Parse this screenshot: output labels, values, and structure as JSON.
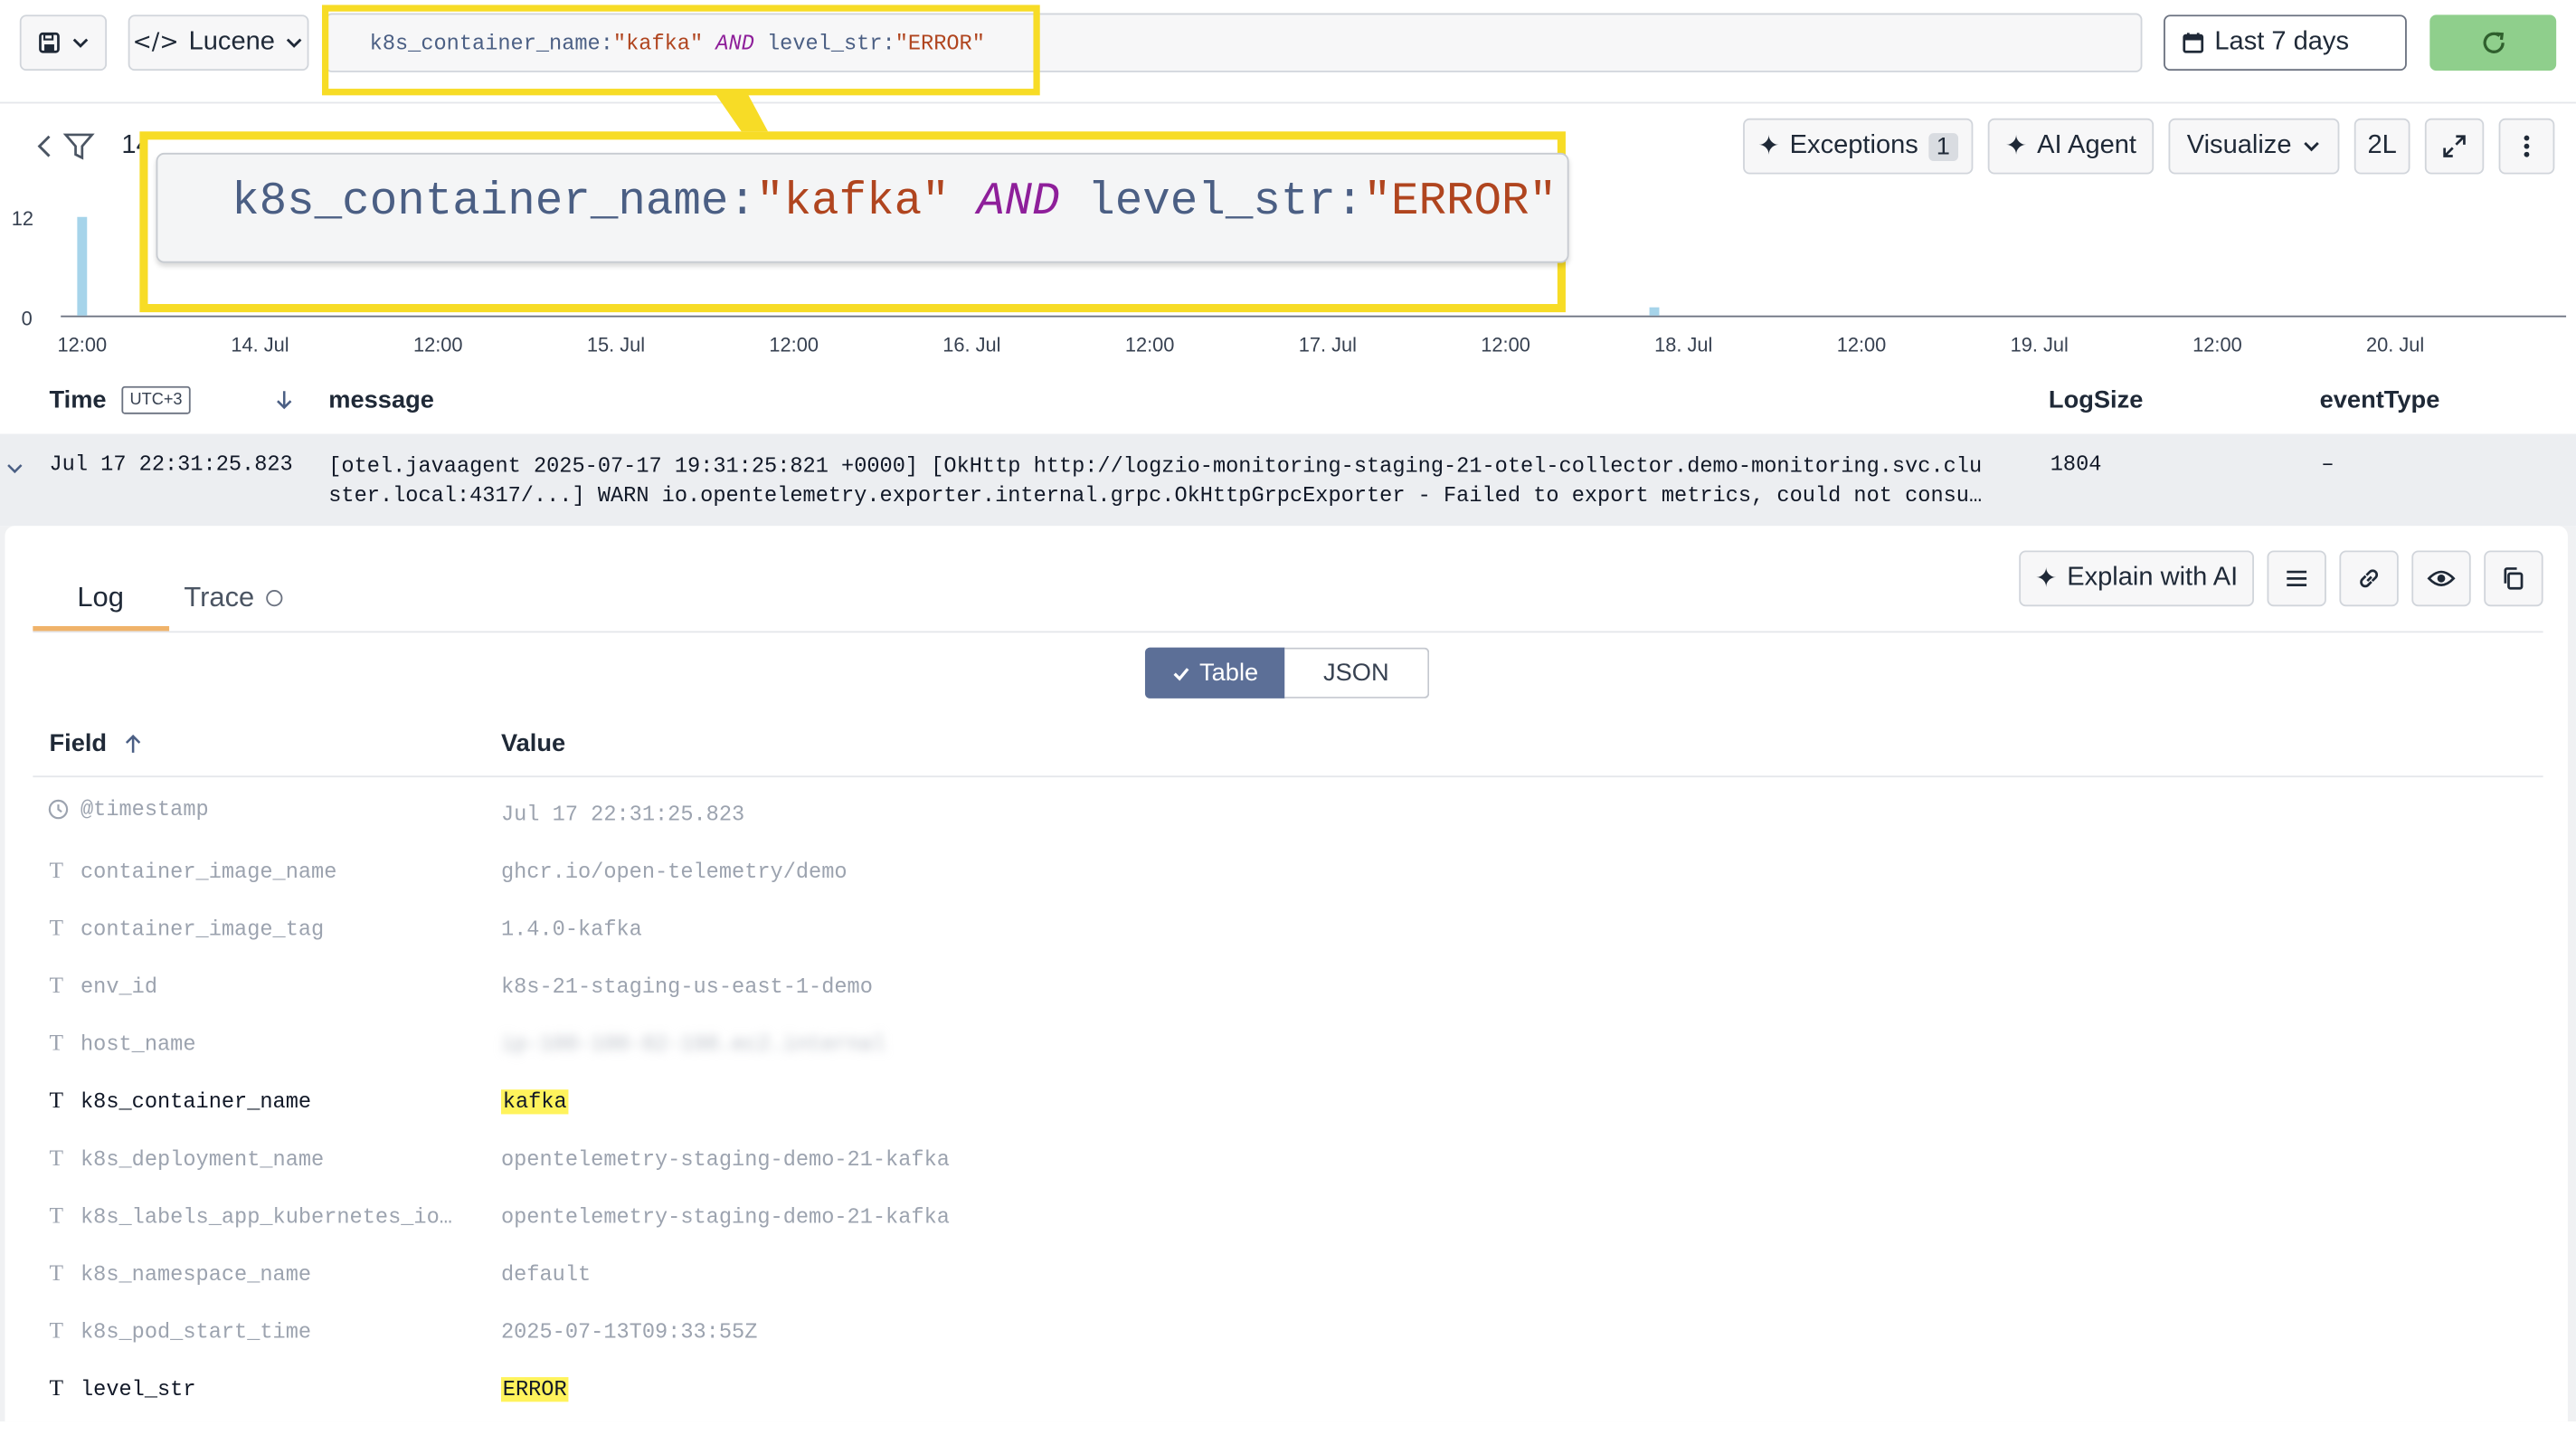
{
  "toolbar": {
    "query_language": "Lucene",
    "query_parts": [
      "k8s_container_name",
      ":",
      "\"kafka\"",
      " AND ",
      "level_str",
      ":",
      "\"ERROR\""
    ],
    "time_range": "Last 7 days"
  },
  "zoom_callout": {
    "parts": [
      "k8s_container_name",
      ":",
      "\"kafka\"",
      " AND ",
      "level_str",
      ":",
      "\"ERROR\""
    ]
  },
  "actions": {
    "exceptions_label": "Exceptions",
    "exceptions_count": "1",
    "ai_agent_label": "AI Agent",
    "visualize_label": "Visualize",
    "lines_label": "2L"
  },
  "hits_partial": "14",
  "chart_data": {
    "type": "bar",
    "y_ticks": [
      "12",
      "0"
    ],
    "x_ticks": [
      "12:00",
      "14. Jul",
      "12:00",
      "15. Jul",
      "12:00",
      "16. Jul",
      "12:00",
      "17. Jul",
      "12:00",
      "18. Jul",
      "12:00",
      "19. Jul",
      "12:00",
      "20. Jul"
    ],
    "ylim": [
      0,
      12
    ],
    "x_domain": [
      "2025-07-13T12:00",
      "2025-07-20T00:00"
    ],
    "bars": [
      {
        "x": "2025-07-13T12:00",
        "value": 12
      },
      {
        "x": "2025-07-17T22:00",
        "value": 1
      }
    ],
    "bar_color": "#a6d4ea"
  },
  "table": {
    "headers": {
      "time": "Time",
      "tz": "UTC+3",
      "message": "message",
      "logsize": "LogSize",
      "eventtype": "eventType"
    },
    "row": {
      "time": "Jul 17 22:31:25.823",
      "message_line1": "[otel.javaagent 2025-07-17 19:31:25:821 +0000] [OkHttp http://logzio-monitoring-staging-21-otel-collector.demo-monitoring.svc.clu",
      "message_line2": "ster.local:4317/...] WARN io.opentelemetry.exporter.internal.grpc.OkHttpGrpcExporter - Failed to export metrics, could not consu…",
      "logsize": "1804",
      "eventtype": "–"
    }
  },
  "detail": {
    "tabs": [
      "Log",
      "Trace"
    ],
    "explain_label": "Explain with AI",
    "view_toggle": [
      "Table",
      "JSON"
    ],
    "field_header": "Field",
    "value_header": "Value",
    "fields": [
      {
        "name": "@timestamp",
        "value": "Jul 17 22:31:25.823",
        "icon": "clock-icon"
      },
      {
        "name": "container_image_name",
        "value": "ghcr.io/open-telemetry/demo",
        "icon": "T"
      },
      {
        "name": "container_image_tag",
        "value": "1.4.0-kafka",
        "icon": "T"
      },
      {
        "name": "env_id",
        "value": "k8s-21-staging-us-east-1-demo",
        "icon": "T"
      },
      {
        "name": "host_name",
        "value": "ip-100-100-82-198.ec2.internal",
        "icon": "T"
      },
      {
        "name": "k8s_container_name",
        "value": "kafka",
        "icon": "T"
      },
      {
        "name": "k8s_deployment_name",
        "value": "opentelemetry-staging-demo-21-kafka",
        "icon": "T"
      },
      {
        "name": "k8s_labels_app_kubernetes_io…",
        "value": "opentelemetry-staging-demo-21-kafka",
        "icon": "T"
      },
      {
        "name": "k8s_namespace_name",
        "value": "default",
        "icon": "T"
      },
      {
        "name": "k8s_pod_start_time",
        "value": "2025-07-13T09:33:55Z",
        "icon": "T"
      },
      {
        "name": "level_str",
        "value": "ERROR",
        "icon": "T"
      }
    ]
  }
}
